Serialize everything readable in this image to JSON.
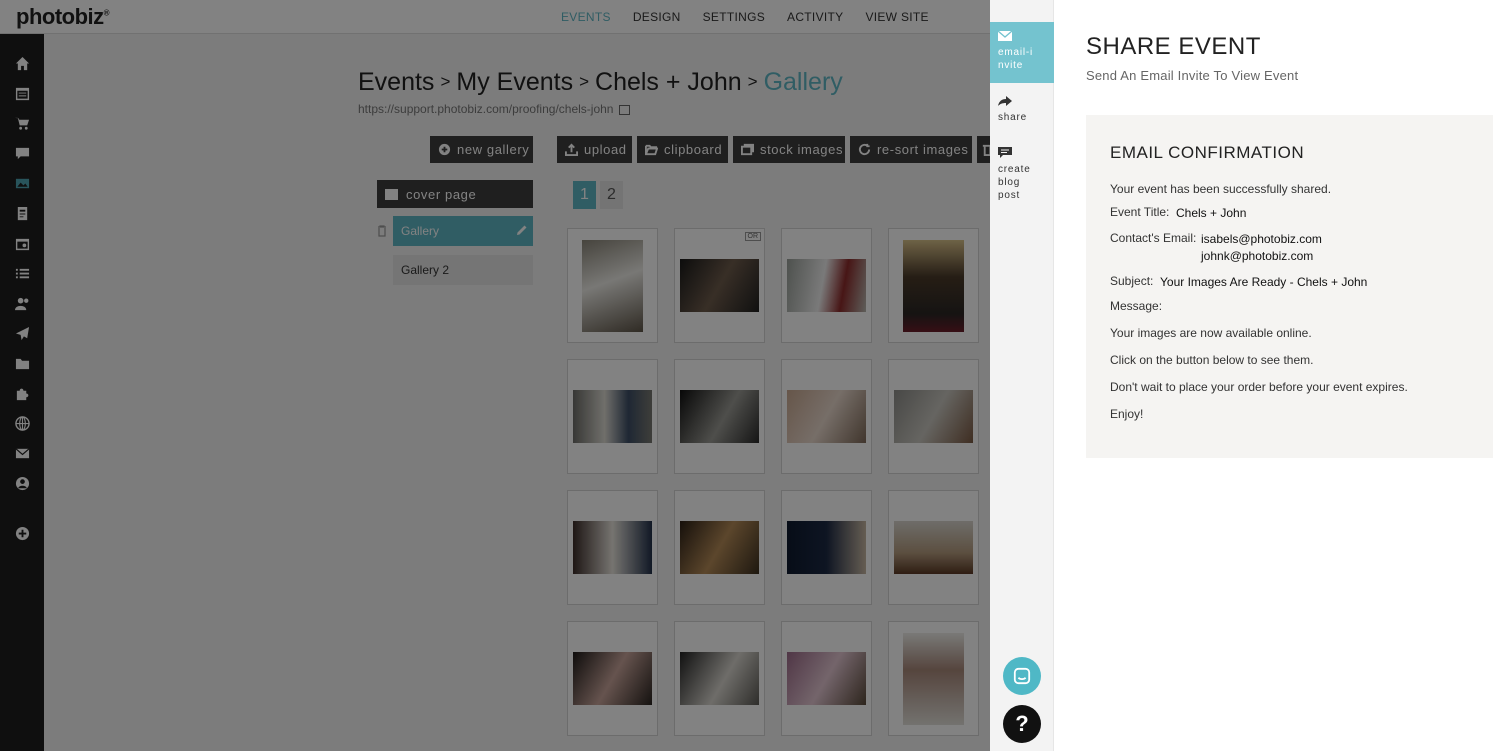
{
  "brand": {
    "logo": "photobiz"
  },
  "topnav": [
    "EVENTS",
    "DESIGN",
    "SETTINGS",
    "ACTIVITY",
    "VIEW SITE"
  ],
  "sidebar_icons": [
    "home-icon",
    "calendar-list-icon",
    "cart-icon",
    "chat-icon",
    "gallery-icon",
    "document-icon",
    "event-calendar-icon",
    "list-icon",
    "contacts-icon",
    "send-icon",
    "folder-icon",
    "puzzle-icon",
    "globe-icon",
    "mail-icon",
    "account-icon",
    "add-icon"
  ],
  "breadcrumb": {
    "items": [
      "Events",
      "My Events",
      "Chels + John"
    ],
    "current": "Gallery",
    "separator": ">"
  },
  "event_url": "https://support.photobiz.com/proofing/chels-john",
  "toolbar": {
    "new_gallery": "new gallery",
    "upload": "upload",
    "clipboard": "clipboard",
    "stock_images": "stock images",
    "resort_images": "re-sort images"
  },
  "galleries": {
    "cover_page": "cover page",
    "active": "Gallery",
    "second": "Gallery 2"
  },
  "pager": [
    "1",
    "2"
  ],
  "thumb_badge": "OR",
  "share_tabs": [
    {
      "label": "email-invite",
      "icon": "mail-icon",
      "active": true
    },
    {
      "label": "share",
      "icon": "share-arrow-icon",
      "active": false
    },
    {
      "label": "create blog post",
      "icon": "comment-icon",
      "active": false
    }
  ],
  "share": {
    "title": "SHARE EVENT",
    "subtitle": "Send An Email Invite To View Event",
    "confirmation": {
      "title": "EMAIL CONFIRMATION",
      "status": "Your event has been successfully shared.",
      "event_title_label": "Event Title:",
      "event_title": "Chels + John",
      "contact_label": "Contact's Email:",
      "emails": [
        "isabels@photobiz.com",
        "johnk@photobiz.com"
      ],
      "subject_label": "Subject:",
      "subject": "Your Images Are Ready - Chels + John",
      "message_label": "Message:",
      "message_lines": [
        "Your images are now available online.",
        "Click on the button below to see them.",
        "Don't wait to place your order before your event expires.",
        "Enjoy!"
      ]
    }
  },
  "help": {
    "label": "?"
  },
  "colors": {
    "accent": "#5fb6c4",
    "dark_button": "#3e3e3e",
    "sidebar": "#1f1f1f"
  }
}
